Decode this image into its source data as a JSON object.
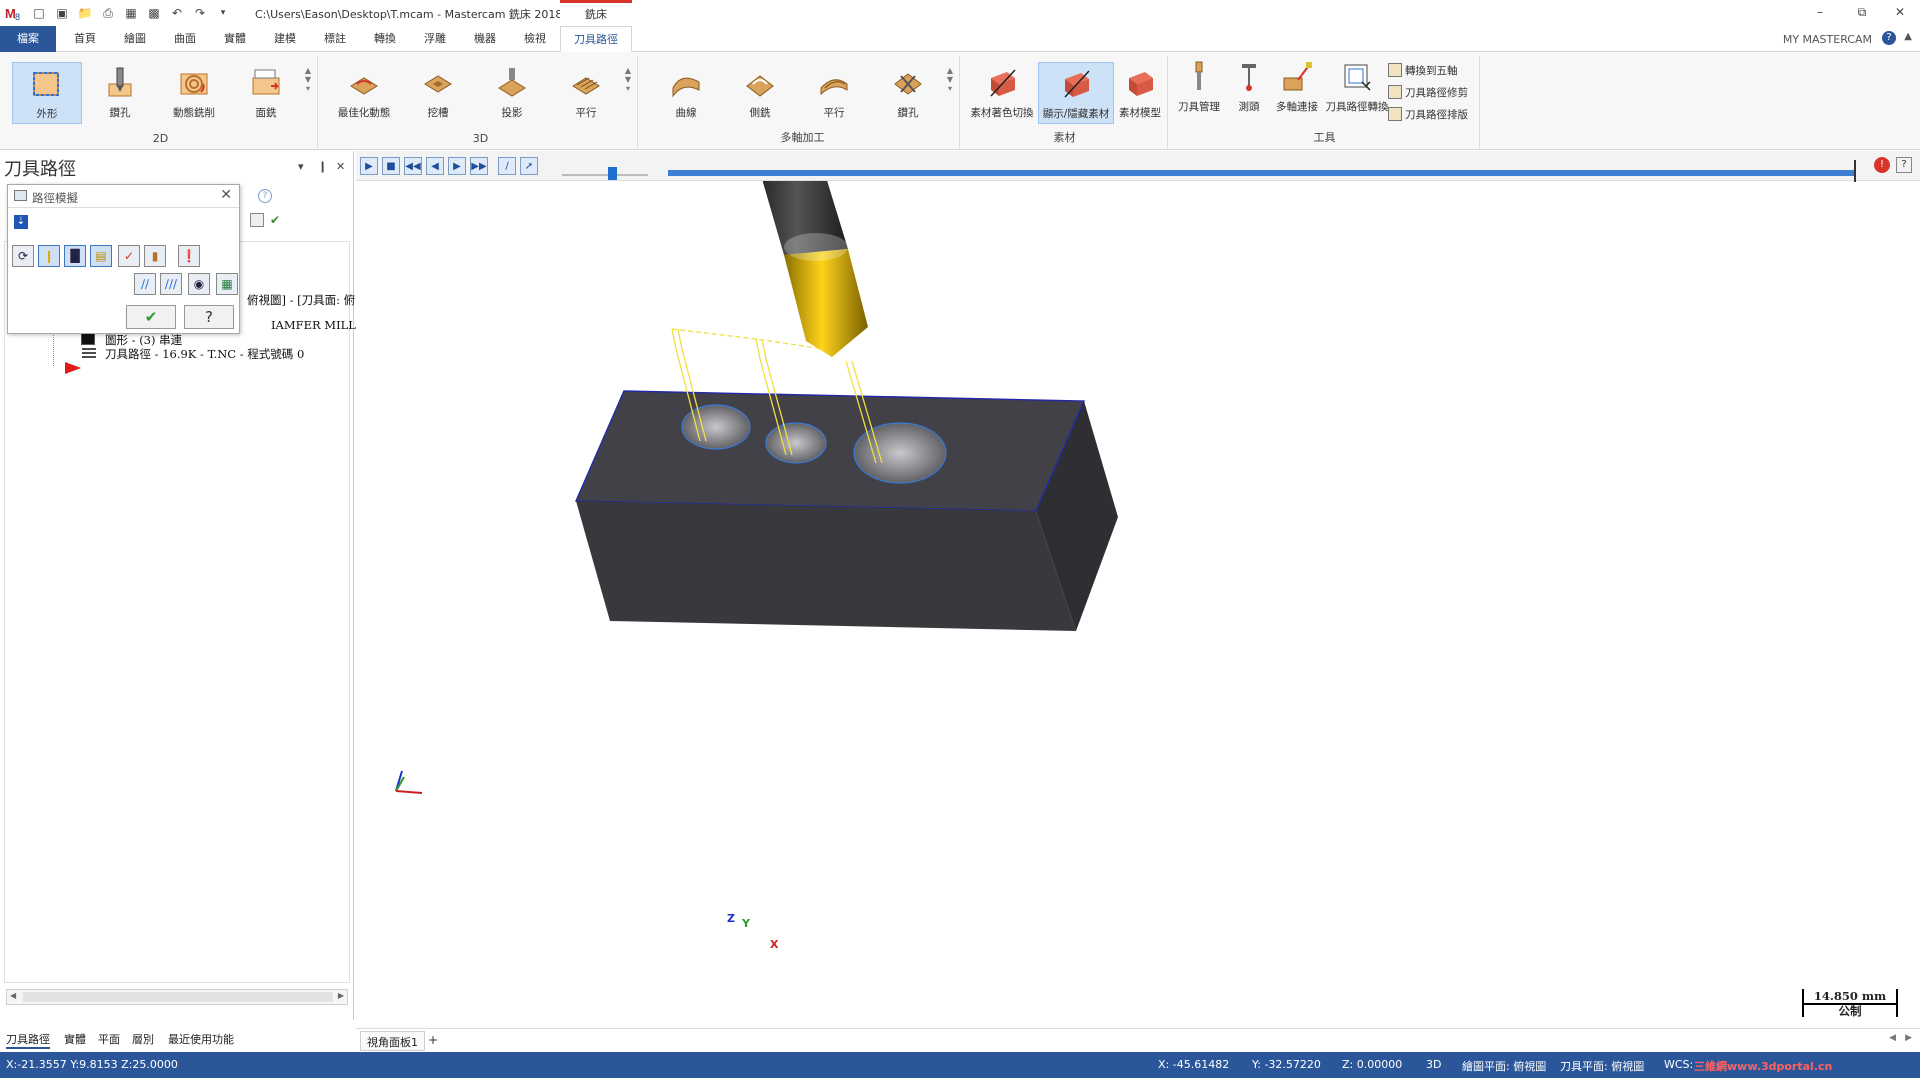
{
  "window": {
    "title": "C:\\Users\\Eason\\Desktop\\T.mcam - Mastercam 銑床 2018",
    "context_tab": "銑床",
    "my_mastercam": "MY MASTERCAM"
  },
  "ribbon_tabs": [
    "檔案",
    "首頁",
    "繪圖",
    "曲面",
    "實體",
    "建模",
    "標註",
    "轉換",
    "浮雕",
    "機器",
    "檢視",
    "刀具路徑"
  ],
  "ribbon": {
    "group_2d": {
      "label": "2D",
      "buttons": [
        "外形",
        "鑽孔",
        "動態銑削",
        "面銑"
      ]
    },
    "group_3d": {
      "label": "3D",
      "buttons": [
        "最佳化動態",
        "挖槽",
        "投影",
        "平行"
      ]
    },
    "group_multiaxis": {
      "label": "多軸加工",
      "buttons": [
        "曲線",
        "側銑",
        "平行",
        "鑽孔"
      ]
    },
    "group_stock": {
      "label": "素材",
      "buttons": [
        "素材著色切換",
        "顯示/隱藏素材",
        "素材模型"
      ]
    },
    "group_tools": {
      "label": "工具",
      "buttons": [
        "刀具管理",
        "測頭",
        "多軸連接",
        "刀具路徑轉換"
      ],
      "mini": [
        "轉換到五軸",
        "刀具路徑修剪",
        "刀具路徑排版"
      ]
    }
  },
  "left_panel": {
    "title": "刀具路徑",
    "tree": {
      "row_plane": "俯視圖] - [刀具面: 俯",
      "row_tool": "IAMFER MILL",
      "row_geometry": "圖形 - (3) 串連",
      "row_toolpath": "刀具路徑 - 16.9K - T.NC - 程式號碼 0"
    }
  },
  "dialog": {
    "title": "路徑模擬"
  },
  "manager_tabs": [
    "刀具路徑",
    "實體",
    "平面",
    "層別",
    "最近使用功能"
  ],
  "viewport": {
    "scale_value": "14.850 mm",
    "scale_unit": "公制",
    "axis_labels": {
      "x": "X",
      "y": "Y",
      "z": "Z"
    },
    "progress": 1.0
  },
  "viewsheet": {
    "tab": "視角面板1",
    "add": "+"
  },
  "statusbar": {
    "cursor": "X:-21.3557   Y:9.8153   Z:25.0000",
    "x": "X:     -45.61482",
    "y": "Y:     -32.57220",
    "z": "Z:   0.00000",
    "mode": "3D",
    "draw_plane": "繪圖平面: 俯視圖",
    "tool_plane": "刀具平面: 俯視圖",
    "wcs": "WCS:",
    "watermark": "三維網www.3dportal.cn"
  },
  "colors": {
    "accent": "#2b579a",
    "context_red": "#d9342b",
    "stock": "#3a3a3e",
    "toolpath": "#f0e040"
  }
}
